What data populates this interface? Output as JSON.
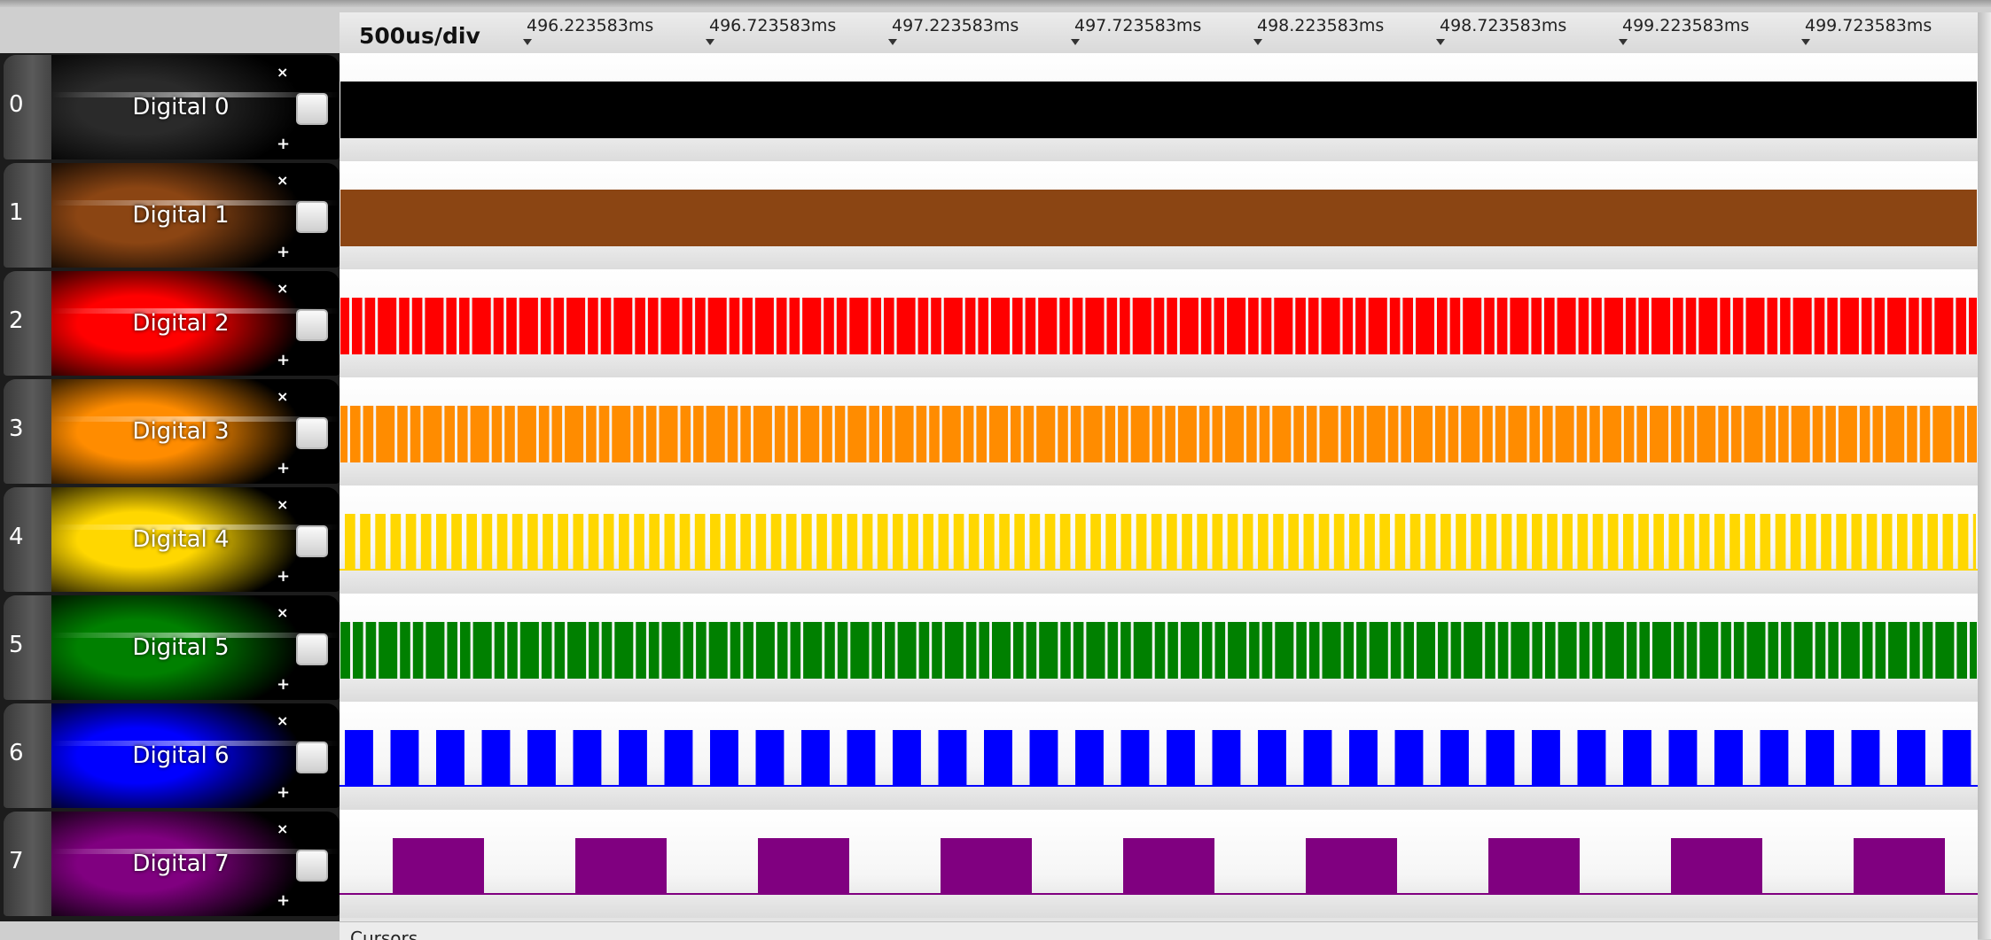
{
  "timebar": {
    "scale_label": "500us/div",
    "ticks": [
      "496.223583ms",
      "496.723583ms",
      "497.223583ms",
      "497.723583ms",
      "498.223583ms",
      "498.723583ms",
      "499.223583ms",
      "499.723583ms"
    ]
  },
  "channels": [
    {
      "index": "0",
      "name": "Digital 0",
      "color": "#000000",
      "signal": "solid",
      "pulses_per_div": 0
    },
    {
      "index": "1",
      "name": "Digital 1",
      "color": "#8B4513",
      "signal": "solid",
      "pulses_per_div": 0
    },
    {
      "index": "2",
      "name": "Digital 2",
      "color": "#FF0000",
      "signal": "dense",
      "pulses_per_div": 12
    },
    {
      "index": "3",
      "name": "Digital 3",
      "color": "#FF8C00",
      "signal": "dense",
      "pulses_per_div": 12
    },
    {
      "index": "4",
      "name": "Digital 4",
      "color": "#FFD700",
      "signal": "pulses",
      "pulses_per_div": 12
    },
    {
      "index": "5",
      "name": "Digital 5",
      "color": "#008000",
      "signal": "dense",
      "pulses_per_div": 12
    },
    {
      "index": "6",
      "name": "Digital 6",
      "color": "#0000FF",
      "signal": "pulses",
      "pulses_per_div": 4
    },
    {
      "index": "7",
      "name": "Digital 7",
      "color": "#800080",
      "signal": "pulses",
      "pulses_per_div": 1
    }
  ],
  "buttons": {
    "remove": "×",
    "add": "+"
  },
  "cursors": {
    "label": "Cursors"
  }
}
